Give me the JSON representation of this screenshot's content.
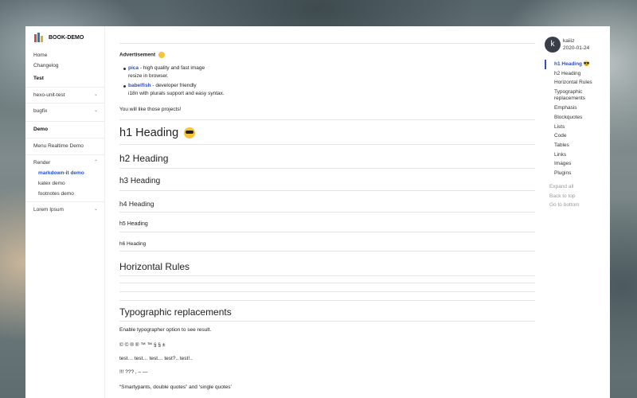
{
  "sidebar": {
    "brand": "BOOK-DEMO",
    "items": [
      {
        "label": "Home"
      },
      {
        "label": "Changelog"
      }
    ],
    "section_test": "Test",
    "test_items": [
      {
        "label": "hexo-unit-test",
        "chevron": "⌄"
      },
      {
        "label": "bugfix",
        "chevron": "⌄"
      }
    ],
    "section_demo": "Demo",
    "demo_items": [
      {
        "label": "Menu Realtime Demo"
      },
      {
        "label": "Render",
        "chevron": "⌃"
      }
    ],
    "render_items": [
      {
        "label": "markdown-it demo"
      },
      {
        "label": "katex demo"
      },
      {
        "label": "footnotes demo"
      }
    ],
    "lorem": {
      "label": "Lorem Ipsum",
      "chevron": "⌄"
    }
  },
  "main": {
    "ad_title": "Advertisement",
    "ads": [
      {
        "link": "pica",
        "text": " - high quality and fast image",
        "text2": "resize in browser."
      },
      {
        "link": "babelfish",
        "text": " - developer friendly",
        "text2": "i18n with plurals support and easy syntax."
      }
    ],
    "closing": "You will like those projects!",
    "h1": "h1 Heading",
    "h2": "h2 Heading",
    "h3": "h3 Heading",
    "h4": "h4 Heading",
    "h5": "h5 Heading",
    "h6": "h6 Heading",
    "hr_heading": "Horizontal Rules",
    "typo_heading": "Typographic replacements",
    "typo_intro": "Enable typographer option to see result.",
    "typo_symbols": "© © ® ® ™ ™ § § ±",
    "typo_dots": "test… test… test… test?.. test!..",
    "typo_marks": "!!! ??? , – —",
    "typo_quotes": "“Smartypants, double quotes” and ‘single quotes’"
  },
  "toc": {
    "avatar_letter": "k",
    "author": "kaiiiz",
    "date": "2020-01-24",
    "items": [
      {
        "label": "h1 Heading 😎"
      },
      {
        "label": "h2 Heading"
      },
      {
        "label": "Horizontal Rules"
      },
      {
        "label": "Typographic replacements"
      },
      {
        "label": "Emphasis"
      },
      {
        "label": "Blockquotes"
      },
      {
        "label": "Lists"
      },
      {
        "label": "Code"
      },
      {
        "label": "Tables"
      },
      {
        "label": "Links"
      },
      {
        "label": "Images"
      },
      {
        "label": "Plugins"
      }
    ],
    "expand_all": "Expand all",
    "back_to_top": "Back to top",
    "go_to_bottom": "Go to bottom"
  },
  "colors": {
    "accent": "#2c4fc4",
    "emoji": "#f6c33b"
  }
}
